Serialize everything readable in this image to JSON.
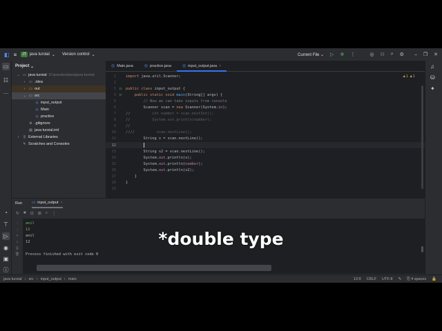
{
  "titlebar": {
    "project_badge": "JT",
    "project": "java turoial",
    "vcs": "Version control",
    "run_config": "Current File"
  },
  "project": {
    "title": "Project",
    "items": [
      {
        "label": "java turoial",
        "path": "D:\\practice\\java\\java turoial",
        "icon": "folder",
        "indent": 0,
        "arrow": "v"
      },
      {
        "label": ".idea",
        "icon": "folder",
        "indent": 1,
        "arrow": ">"
      },
      {
        "label": "out",
        "icon": "folder",
        "indent": 1,
        "arrow": ">",
        "state": "out"
      },
      {
        "label": "src",
        "icon": "folder",
        "indent": 1,
        "arrow": "v",
        "state": "sel"
      },
      {
        "label": "input_output",
        "icon": "class",
        "indent": 2
      },
      {
        "label": "Main",
        "icon": "class",
        "indent": 2
      },
      {
        "label": "practice",
        "icon": "class",
        "indent": 2
      },
      {
        "label": ".gitignore",
        "icon": "ignore",
        "indent": 1
      },
      {
        "label": "java turoial.iml",
        "icon": "file",
        "indent": 1
      },
      {
        "label": "External Libraries",
        "icon": "library",
        "indent": 0,
        "arrow": ">"
      },
      {
        "label": "Scratches and Consoles",
        "icon": "scratch",
        "indent": 0
      }
    ]
  },
  "editor": {
    "tabs": [
      {
        "label": "Main.java"
      },
      {
        "label": "practice.java"
      },
      {
        "label": "input_output.java",
        "active": true
      }
    ],
    "warnings": "▲1 ▲1",
    "current_line": 12,
    "lines": [
      [
        [
          "import",
          "kw"
        ],
        [
          " java.util.Scanner;",
          "tx"
        ]
      ],
      [],
      [
        [
          "public class",
          "kw"
        ],
        [
          " input_output {",
          "tx"
        ]
      ],
      [
        [
          "    public static void ",
          "kw"
        ],
        [
          "main",
          "fn"
        ],
        [
          "(String[] args) {",
          "tx"
        ]
      ],
      [
        [
          "        // Now we can take inputs from console",
          "cm"
        ]
      ],
      [
        [
          "        Scanner scan = ",
          "tx"
        ],
        [
          "new",
          "kw"
        ],
        [
          " Scanner(System.",
          "tx"
        ],
        [
          "in",
          "st"
        ],
        [
          ");",
          "tx"
        ]
      ],
      [
        [
          "//",
          "cm"
        ],
        [
          "          int number = scan.nextInt();",
          "dc"
        ]
      ],
      [
        [
          "//",
          "cm"
        ],
        [
          "          System.out.println(number);",
          "dc"
        ]
      ],
      [
        [
          "//",
          "cm"
        ]
      ],
      [
        [
          "////",
          "cm"
        ],
        [
          "          scan.nextLine();",
          "dc"
        ]
      ],
      [
        [
          "        String s = scan.nextLine();",
          "tx"
        ]
      ],
      [
        [
          "        ",
          "tx"
        ]
      ],
      [
        [
          "        String s2 = scan.nextLine();",
          "tx"
        ]
      ],
      [
        [
          "        System.",
          "tx"
        ],
        [
          "out",
          "st"
        ],
        [
          ".println(s);",
          "tx"
        ]
      ],
      [
        [
          "        System.",
          "tx"
        ],
        [
          "out",
          "st"
        ],
        [
          ".println(",
          "tx"
        ],
        [
          "number",
          "st"
        ],
        [
          ");",
          "tx"
        ]
      ],
      [
        [
          "        System.",
          "tx"
        ],
        [
          "out",
          "st"
        ],
        [
          ".println(s2);",
          "tx"
        ]
      ],
      [
        [
          "    }",
          "tx"
        ]
      ],
      [
        [
          "}",
          "tx"
        ]
      ],
      []
    ]
  },
  "run": {
    "title": "Run",
    "tab": "input_output",
    "output": [
      {
        "text": "anil",
        "input": true
      },
      {
        "text": "12",
        "input": true
      },
      {
        "text": "anil"
      },
      {
        "text": "12"
      },
      {
        "text": ""
      },
      {
        "text": "Process finished with exit code 0"
      }
    ]
  },
  "caption": "*double type",
  "status": {
    "breadcrumb": [
      "java turoial",
      "src",
      "input_output",
      "main"
    ],
    "position": "12:9",
    "line_sep": "CRLF",
    "encoding": "UTF-8",
    "indent": "4 spaces"
  }
}
